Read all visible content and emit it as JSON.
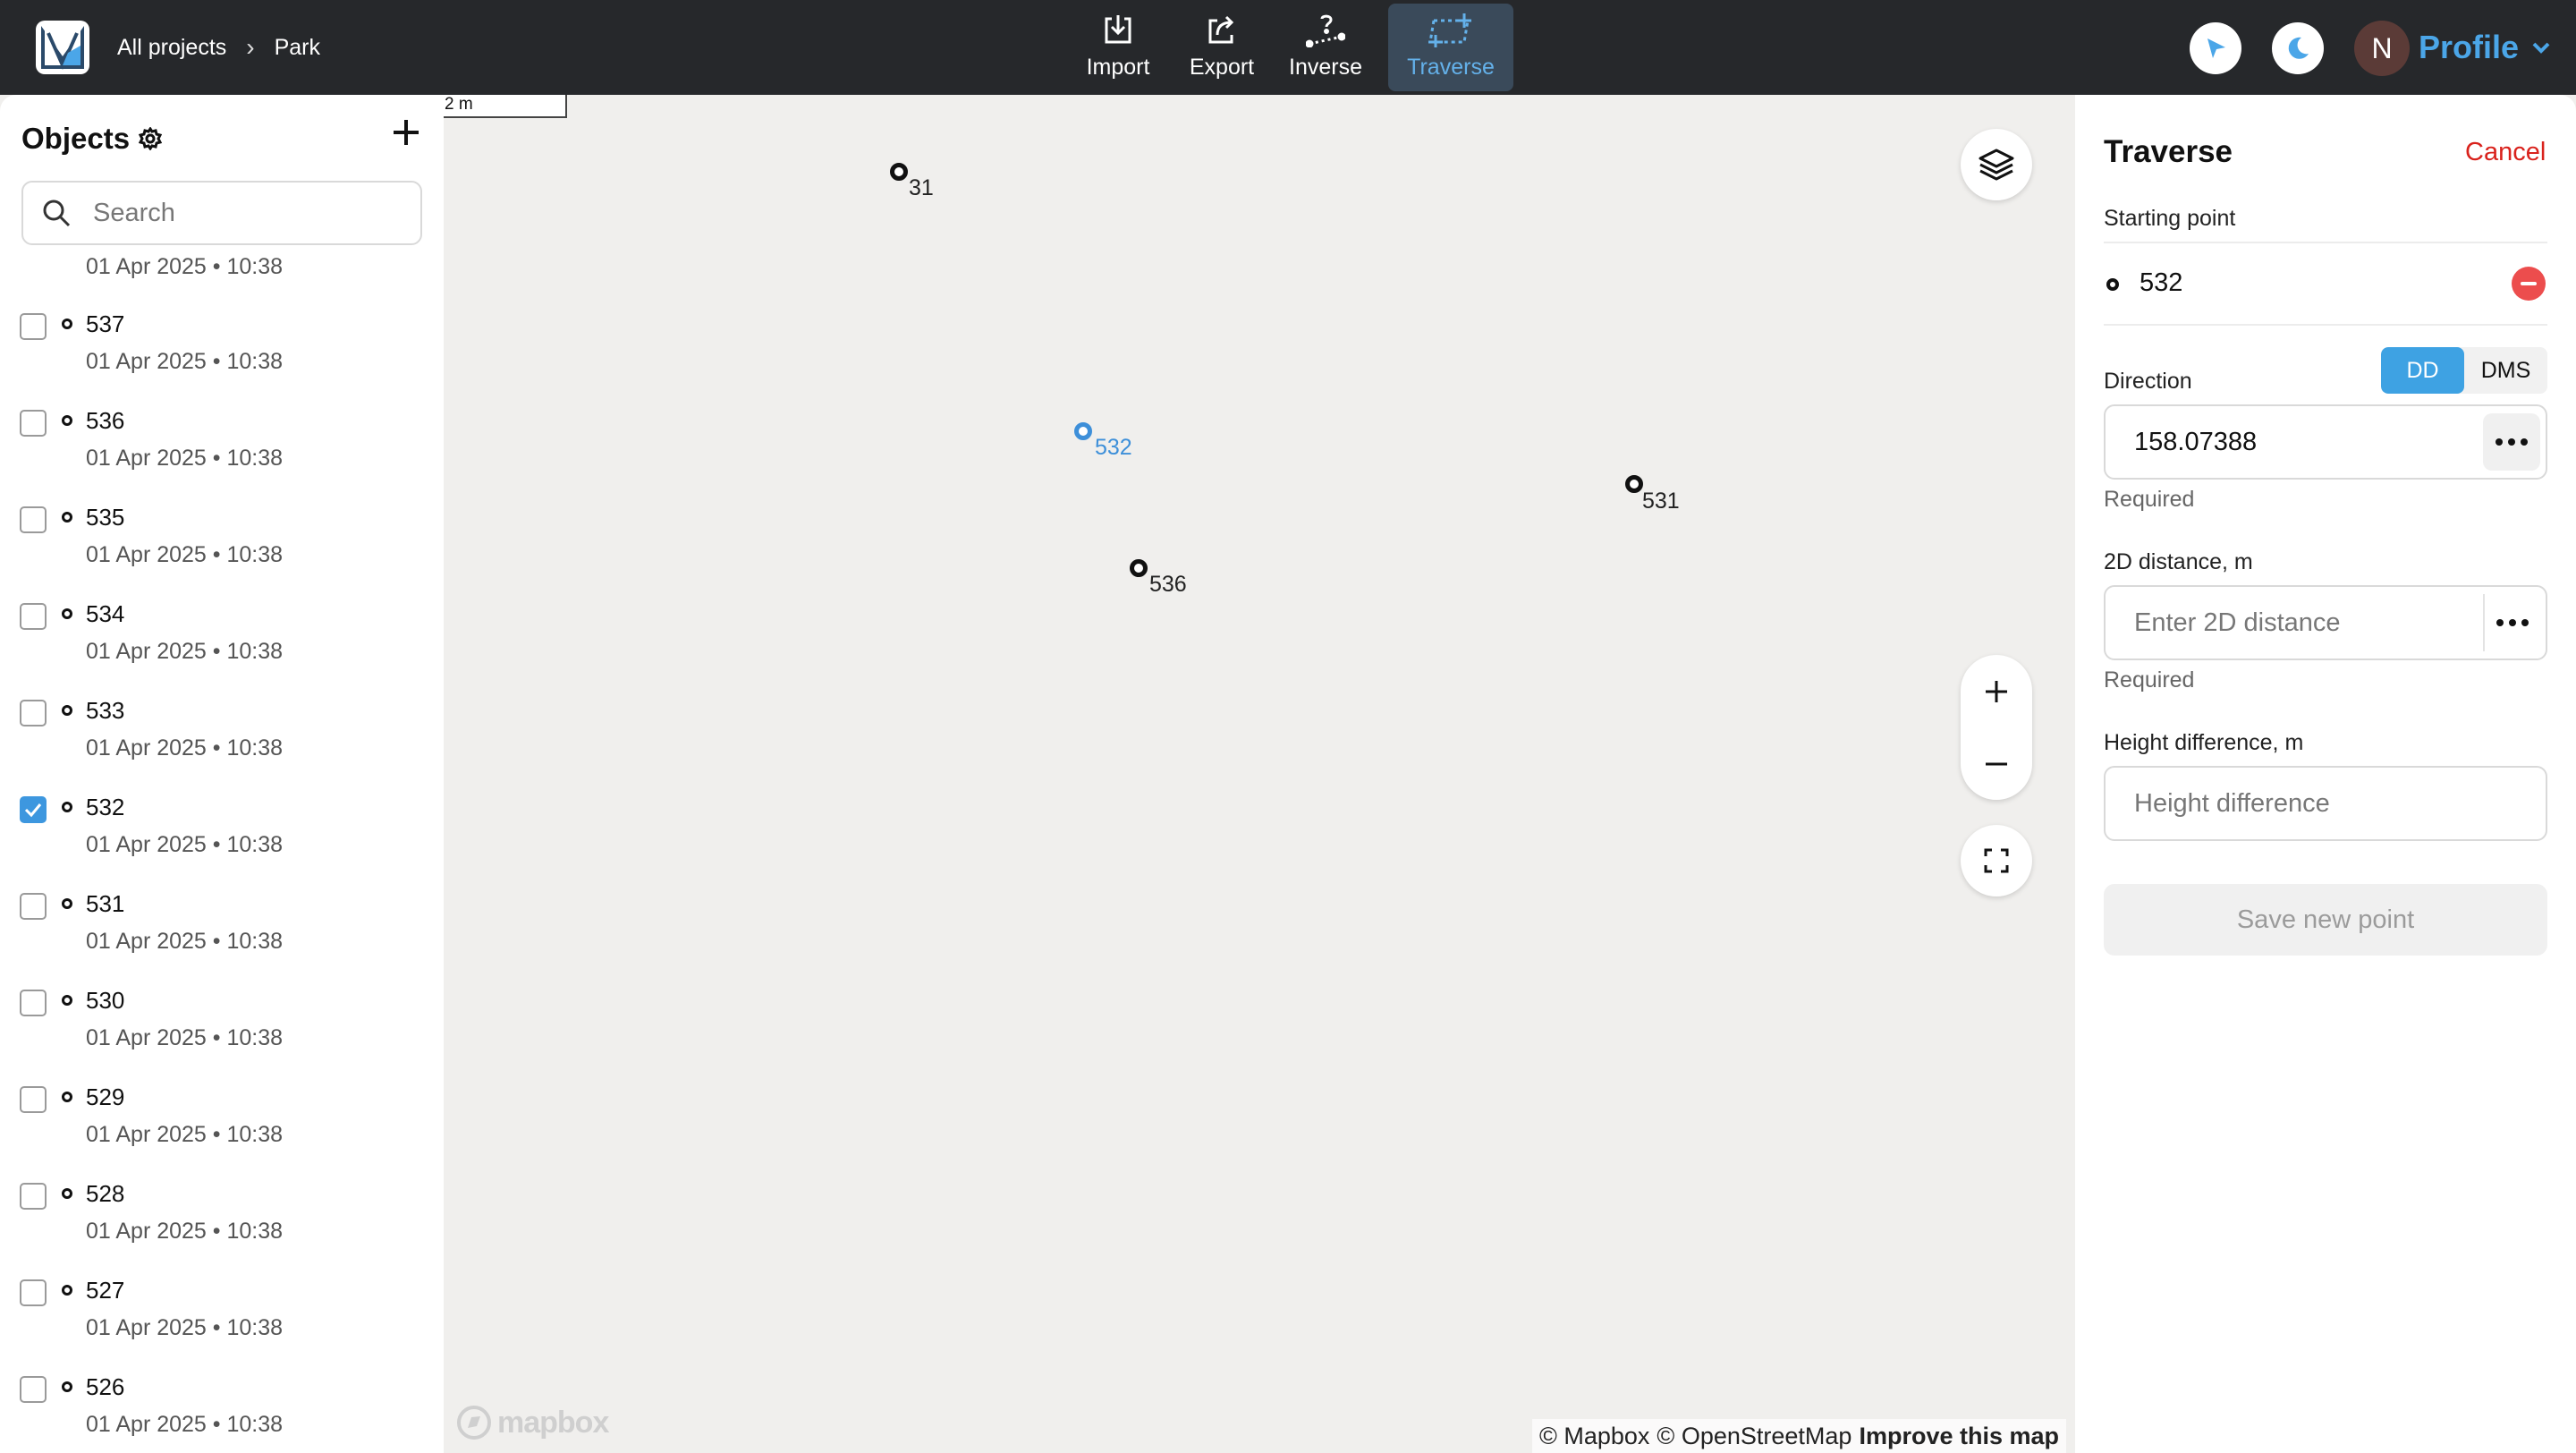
{
  "header": {
    "breadcrumbs": [
      "All projects",
      "Park"
    ],
    "tools": [
      {
        "label": "Import",
        "icon": "import-icon"
      },
      {
        "label": "Export",
        "icon": "export-icon"
      },
      {
        "label": "Inverse",
        "icon": "inverse-icon"
      },
      {
        "label": "Traverse",
        "icon": "traverse-icon",
        "active": true
      }
    ],
    "avatar_initial": "N",
    "profile_label": "Profile",
    "accent_color": "#4ba6e8"
  },
  "objects_panel": {
    "title": "Objects",
    "search_placeholder": "Search",
    "first_date": "01 Apr 2025 • 10:38",
    "items": [
      {
        "name": "537",
        "date": "01 Apr 2025 • 10:38",
        "checked": false
      },
      {
        "name": "536",
        "date": "01 Apr 2025 • 10:38",
        "checked": false
      },
      {
        "name": "535",
        "date": "01 Apr 2025 • 10:38",
        "checked": false
      },
      {
        "name": "534",
        "date": "01 Apr 2025 • 10:38",
        "checked": false
      },
      {
        "name": "533",
        "date": "01 Apr 2025 • 10:38",
        "checked": false
      },
      {
        "name": "532",
        "date": "01 Apr 2025 • 10:38",
        "checked": true
      },
      {
        "name": "531",
        "date": "01 Apr 2025 • 10:38",
        "checked": false
      },
      {
        "name": "530",
        "date": "01 Apr 2025 • 10:38",
        "checked": false
      },
      {
        "name": "529",
        "date": "01 Apr 2025 • 10:38",
        "checked": false
      },
      {
        "name": "528",
        "date": "01 Apr 2025 • 10:38",
        "checked": false
      },
      {
        "name": "527",
        "date": "01 Apr 2025 • 10:38",
        "checked": false
      },
      {
        "name": "526",
        "date": "01 Apr 2025 • 10:38",
        "checked": false
      }
    ]
  },
  "map": {
    "scale_label": "2 m",
    "points": [
      {
        "label": "31",
        "selected": false
      },
      {
        "label": "532",
        "selected": true
      },
      {
        "label": "531",
        "selected": false
      },
      {
        "label": "536",
        "selected": false
      }
    ],
    "mapbox_logo": "mapbox",
    "attribution": {
      "mapbox": "© Mapbox",
      "osm": "© OpenStreetMap",
      "improve": "Improve this map"
    }
  },
  "traverse": {
    "title": "Traverse",
    "cancel_label": "Cancel",
    "starting_point_label": "Starting point",
    "starting_point": "532",
    "direction_label": "Direction",
    "format_options": [
      "DD",
      "DMS"
    ],
    "format_selected": "DD",
    "direction_value": "158.07388",
    "required_label": "Required",
    "distance_label": "2D distance, m",
    "distance_placeholder": "Enter 2D distance",
    "height_label": "Height difference, m",
    "height_placeholder": "Height difference",
    "save_label": "Save new point"
  }
}
